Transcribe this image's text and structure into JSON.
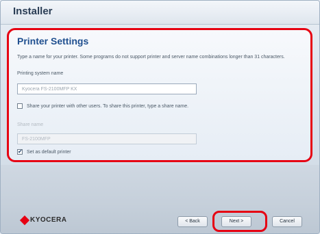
{
  "window": {
    "title": "Installer"
  },
  "panel": {
    "title": "Printer Settings",
    "description": "Type a name for your printer. Some programs do not support printer and server name combinations longer than 31 characters.",
    "printing_system_label": "Printing system name",
    "printing_system_value": "Kyocera FS-2100MFP KX",
    "share_label": "Share your printer with other users. To share this printer, type a share name.",
    "share_checked": false,
    "share_name_label": "Share name",
    "share_name_value": "FS-2100MFP",
    "default_label": "Set as default printer",
    "default_checked": true
  },
  "footer": {
    "brand": "KYOCERA",
    "back_label": "< Back",
    "next_label": "Next >",
    "cancel_label": "Cancel"
  },
  "colors": {
    "highlight": "#e60012",
    "accent_title": "#1f4f8f"
  }
}
